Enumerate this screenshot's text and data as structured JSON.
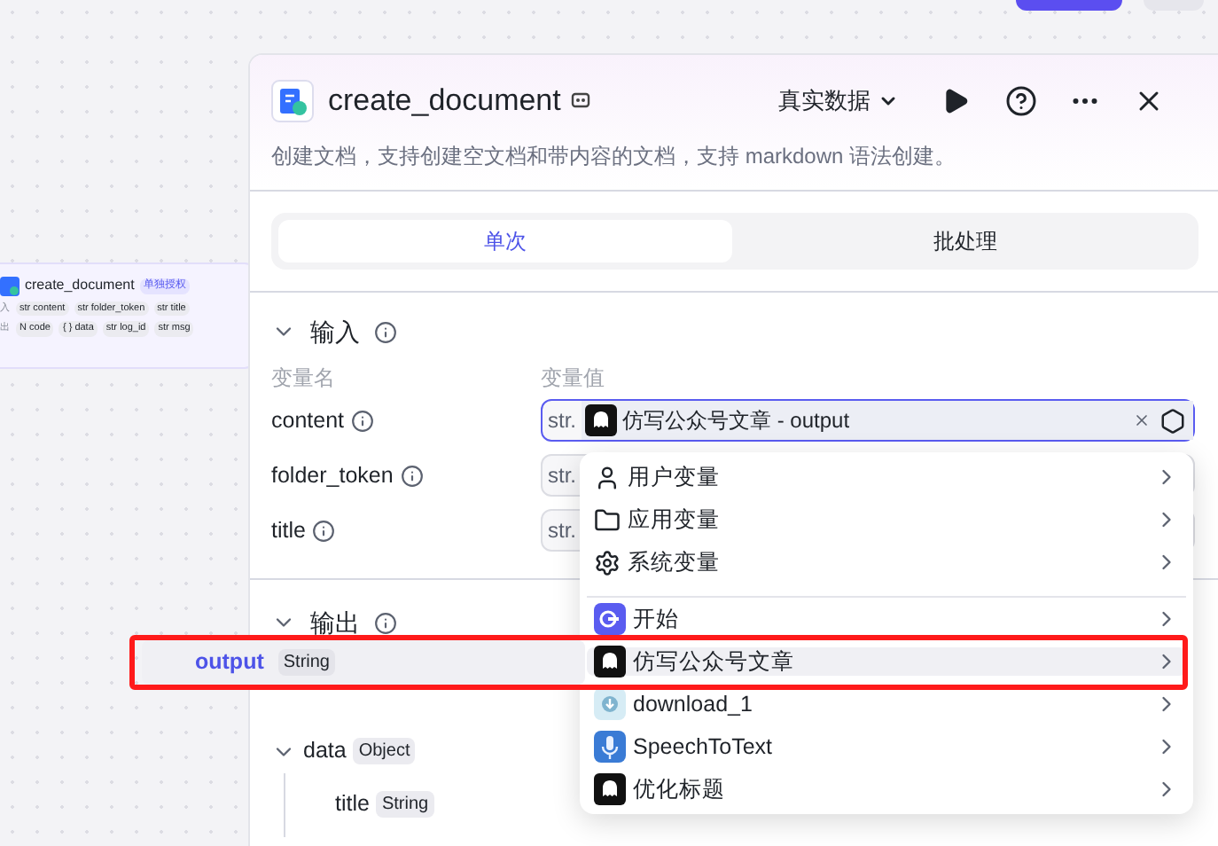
{
  "canvas_node": {
    "title": "create_document",
    "badge": "单独授权",
    "input_label": "入",
    "output_label": "出",
    "inputs": [
      {
        "type": "str",
        "name": "content"
      },
      {
        "type": "str",
        "name": "folder_token"
      },
      {
        "type": "str",
        "name": "title"
      }
    ],
    "outputs": [
      {
        "type": "N",
        "name": "code"
      },
      {
        "type": "{ }",
        "name": "data"
      },
      {
        "type": "str",
        "name": "log_id"
      },
      {
        "type": "str",
        "name": "msg"
      }
    ]
  },
  "panel": {
    "title": "create_document",
    "data_mode": "真实数据",
    "description": "创建文档，支持创建空文档和带内容的文档，支持 markdown 语法创建。",
    "tabs": [
      {
        "label": "单次",
        "selected": true
      },
      {
        "label": "批处理",
        "selected": false
      }
    ],
    "input_section": {
      "title": "输入",
      "expanded": true,
      "columns": [
        "变量名",
        "变量值"
      ],
      "rows": [
        {
          "name": "content",
          "type": "str.",
          "value": "仿写公众号文章 - output"
        },
        {
          "name": "folder_token",
          "type": "str."
        },
        {
          "name": "title",
          "type": "str."
        }
      ]
    },
    "output_section": {
      "title": "输出",
      "expanded": true,
      "fields": [
        {
          "name": "data",
          "type": "Object",
          "expanded": true,
          "children": [
            {
              "name": "title",
              "type": "String"
            }
          ]
        }
      ]
    }
  },
  "highlight": {
    "name": "output",
    "type": "String"
  },
  "menu": {
    "groups": [
      [
        {
          "kind": "user",
          "label": "用户变量",
          "selected": false
        },
        {
          "kind": "folder",
          "label": "应用变量",
          "selected": false
        },
        {
          "kind": "gear",
          "label": "系统变量",
          "selected": false
        }
      ],
      [
        {
          "kind": "start",
          "label": "开始",
          "selected": false
        },
        {
          "kind": "ghost",
          "label": "仿写公众号文章",
          "selected": true
        },
        {
          "kind": "download",
          "label": "download_1",
          "selected": false
        },
        {
          "kind": "speech",
          "label": "SpeechToText",
          "selected": false
        },
        {
          "kind": "ghost",
          "label": "优化标题",
          "selected": false
        }
      ]
    ]
  }
}
